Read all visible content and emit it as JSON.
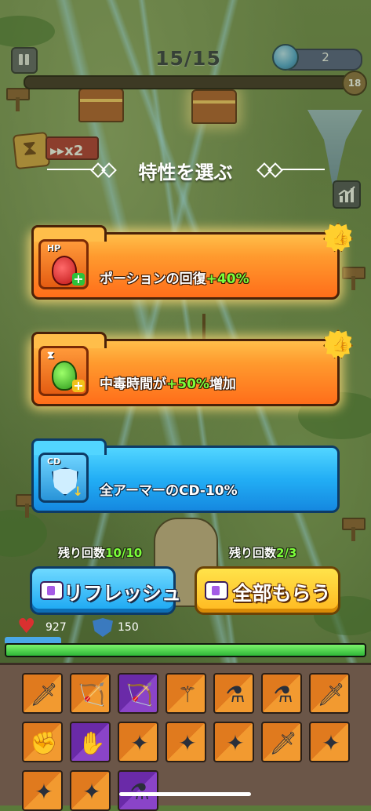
{
  "hud": {
    "wave": "15/15",
    "gems": "2",
    "level": "18",
    "speed_multiplier": "x2"
  },
  "selection": {
    "title": "特性を選ぶ",
    "cards": [
      {
        "tag": "HP",
        "label_prefix": "ポーションの回復",
        "label_highlight": "+40%",
        "label_suffix": "",
        "style": "orange",
        "recommended": true
      },
      {
        "tag": "",
        "label_prefix": "中毒時間が",
        "label_highlight": "+50%",
        "label_suffix": "増加",
        "style": "orange",
        "recommended": true
      },
      {
        "tag": "CD",
        "label_prefix": "全アーマーのCD-10%",
        "label_highlight": "",
        "label_suffix": "",
        "style": "blue",
        "recommended": false
      }
    ],
    "refresh": {
      "remaining_label": "残り回数",
      "remaining_value": "10/10",
      "button_label": "リフレッシュ"
    },
    "take_all": {
      "remaining_label": "残り回数",
      "remaining_value": "2/3",
      "button_label": "全部もらう"
    }
  },
  "player": {
    "hp": "927",
    "armor": "150",
    "hp_fraction": 1.0
  },
  "inventory": {
    "slots": [
      {
        "rarity": "orange",
        "icon": "dagger-icon"
      },
      {
        "rarity": "orange",
        "icon": "bow-icon"
      },
      {
        "rarity": "purple",
        "icon": "bow-icon"
      },
      {
        "rarity": "orange",
        "icon": "staff-icon"
      },
      {
        "rarity": "orange",
        "icon": "potion-icon"
      },
      {
        "rarity": "orange",
        "icon": "potion-icon"
      },
      {
        "rarity": "orange",
        "icon": "dagger-icon"
      },
      {
        "rarity": "orange",
        "icon": "gauntlet-icon"
      },
      {
        "rarity": "purple",
        "icon": "glove-icon"
      },
      {
        "rarity": "orange",
        "icon": "shuriken-icon"
      },
      {
        "rarity": "orange",
        "icon": "shuriken-icon"
      },
      {
        "rarity": "orange",
        "icon": "shuriken-icon"
      },
      {
        "rarity": "orange",
        "icon": "dagger-icon"
      },
      {
        "rarity": "orange",
        "icon": "shuriken-icon"
      },
      {
        "rarity": "orange",
        "icon": "shuriken-icon"
      },
      {
        "rarity": "orange",
        "icon": "shuriken-icon"
      },
      {
        "rarity": "purple",
        "icon": "potion-icon"
      }
    ]
  },
  "colors": {
    "highlight_green": "#7cff3a",
    "card_orange": "#ff8a24",
    "card_blue": "#22aef5",
    "button_yellow": "#ffc928"
  }
}
